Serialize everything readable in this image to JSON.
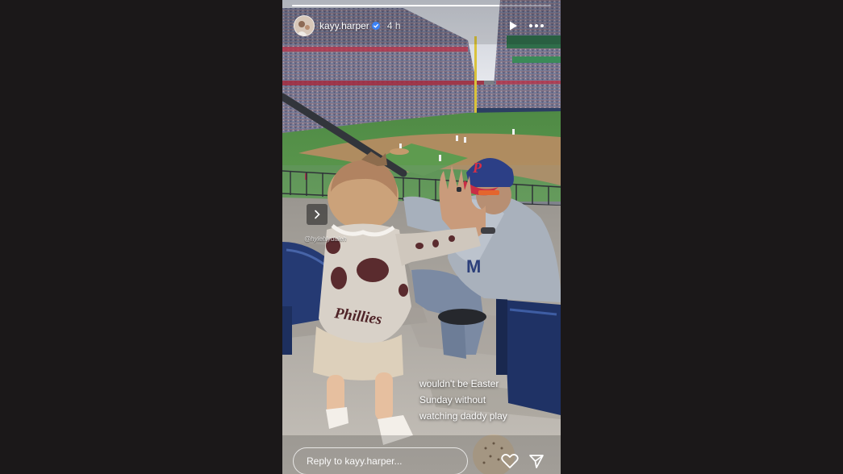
{
  "story": {
    "progress": 0.8,
    "user": {
      "username": "kayy.harper",
      "verified": true,
      "avatar": "avatar-photo",
      "timestamp": "4 h"
    },
    "controls": {
      "play_icon": "play-icon",
      "more_icon": "more-icon",
      "next_icon": "chevron-right-icon"
    },
    "photo_credit": "@hylehlydaleh",
    "caption": {
      "line1": "wouldn't be Easter",
      "line2": "Sunday without",
      "line3": "watching daddy play"
    },
    "reply": {
      "placeholder": "Reply to kayy.harper...",
      "like_icon": "heart-icon",
      "send_icon": "send-icon"
    },
    "colors": {
      "page_background": "#1b1819",
      "text": "#ffffff",
      "accent": "#3b82f6"
    }
  }
}
